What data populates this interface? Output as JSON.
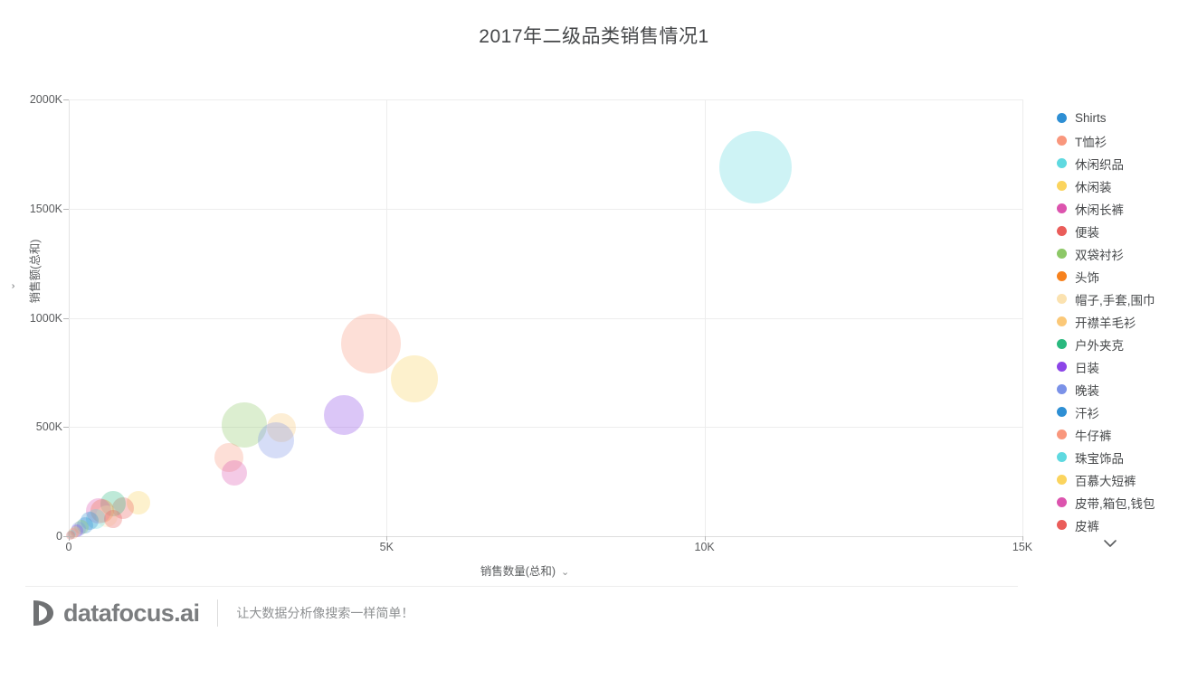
{
  "header": {
    "title": "2017年二级品类销售情况1"
  },
  "axes": {
    "y": {
      "label": "销售额(总和)",
      "caret": "⌄",
      "ticks": [
        "0",
        "500K",
        "1000K",
        "1500K",
        "2000K"
      ]
    },
    "x": {
      "label": "销售数量(总和)",
      "caret": "⌄",
      "ticks": [
        "0",
        "5K",
        "10K",
        "15K"
      ]
    }
  },
  "legend": {
    "more_icon": "chevron-down-icon",
    "items": [
      {
        "label": "Shirts",
        "color": "#2e8fd4"
      },
      {
        "label": "T恤衫",
        "color": "#f9977d"
      },
      {
        "label": "休闲织品",
        "color": "#5fd9e0"
      },
      {
        "label": "休闲装",
        "color": "#fbd45e"
      },
      {
        "label": "休闲长裤",
        "color": "#dc54ae"
      },
      {
        "label": "便装",
        "color": "#ea5d5a"
      },
      {
        "label": "双袋衬衫",
        "color": "#8dc867"
      },
      {
        "label": "头饰",
        "color": "#f7821e"
      },
      {
        "label": "帽子,手套,围巾",
        "color": "#fbe2b0"
      },
      {
        "label": "开襟羊毛衫",
        "color": "#fbc878"
      },
      {
        "label": "户外夹克",
        "color": "#2ab97f"
      },
      {
        "label": "日装",
        "color": "#8c45e8"
      },
      {
        "label": "晚装",
        "color": "#7b92e8"
      },
      {
        "label": "汗衫",
        "color": "#2e8fd4"
      },
      {
        "label": "牛仔裤",
        "color": "#f9977d"
      },
      {
        "label": "珠宝饰品",
        "color": "#5fd9e0"
      },
      {
        "label": "百慕大短裤",
        "color": "#fbd45e"
      },
      {
        "label": "皮带,箱包,钱包",
        "color": "#dc54ae"
      },
      {
        "label": "皮裤",
        "color": "#ea5d5a"
      }
    ]
  },
  "footer": {
    "logo_text": "datafocus.ai",
    "logo_mark": "datafocus-logo-icon",
    "tagline": "让大数据分析像搜索一样简单！"
  },
  "chart_data": {
    "type": "scatter",
    "title": "2017年二级品类销售情况1",
    "xlabel": "销售数量(总和)",
    "ylabel": "销售额(总和)",
    "xlim": [
      0,
      15000
    ],
    "ylim": [
      0,
      2000000
    ],
    "xticks": [
      0,
      5000,
      10000,
      15000
    ],
    "yticks": [
      0,
      500000,
      1000000,
      1500000,
      2000000
    ],
    "grid": true,
    "legend_position": "right",
    "size_encoding": "销售额(总和)",
    "points": [
      {
        "name": "休闲织品",
        "x": 10800,
        "y": 1690000,
        "r": 40,
        "color": "#5fd9e0"
      },
      {
        "name": "T恤衫",
        "x": 4760,
        "y": 880000,
        "r": 33,
        "color": "#f9977d"
      },
      {
        "name": "休闲装",
        "x": 5430,
        "y": 720000,
        "r": 26,
        "color": "#fbd45e"
      },
      {
        "name": "日装",
        "x": 4330,
        "y": 555000,
        "r": 22,
        "color": "#8c45e8"
      },
      {
        "name": "双袋衬衫",
        "x": 2760,
        "y": 508000,
        "r": 25,
        "color": "#8dc867"
      },
      {
        "name": "开襟羊毛衫",
        "x": 3340,
        "y": 495000,
        "r": 16,
        "color": "#fbc878"
      },
      {
        "name": "晚装",
        "x": 3260,
        "y": 440000,
        "r": 20,
        "color": "#7b92e8"
      },
      {
        "name": "牛仔裤",
        "x": 2520,
        "y": 360000,
        "r": 16,
        "color": "#f9977d"
      },
      {
        "name": "休闲长裤",
        "x": 2600,
        "y": 290000,
        "r": 14,
        "color": "#dc54ae"
      },
      {
        "name": "百慕大短裤",
        "x": 1090,
        "y": 155000,
        "r": 13,
        "color": "#fbd45e"
      },
      {
        "name": "便装",
        "x": 860,
        "y": 128000,
        "r": 12,
        "color": "#ea5d5a"
      },
      {
        "name": "户外夹克",
        "x": 700,
        "y": 148000,
        "r": 14,
        "color": "#2ab97f"
      },
      {
        "name": "头饰",
        "x": 520,
        "y": 115000,
        "r": 13,
        "color": "#f7821e"
      },
      {
        "name": "皮带,箱包,钱包",
        "x": 470,
        "y": 118000,
        "r": 14,
        "color": "#dc54ae"
      },
      {
        "name": "帽子,手套,围巾",
        "x": 600,
        "y": 92000,
        "r": 12,
        "color": "#fbe2b0"
      },
      {
        "name": "珠宝饰品",
        "x": 420,
        "y": 78000,
        "r": 11,
        "color": "#5fd9e0"
      },
      {
        "name": "汗衫",
        "x": 330,
        "y": 72000,
        "r": 10,
        "color": "#2e8fd4"
      },
      {
        "name": "皮裤",
        "x": 700,
        "y": 78000,
        "r": 10,
        "color": "#ea5d5a"
      },
      {
        "name": "Shirts",
        "x": 260,
        "y": 50000,
        "r": 9,
        "color": "#2e8fd4"
      },
      {
        "name": "双袋衬衫2",
        "x": 200,
        "y": 42000,
        "r": 8,
        "color": "#8dc867"
      },
      {
        "name": "晚装2",
        "x": 160,
        "y": 34000,
        "r": 8,
        "color": "#7b92e8"
      },
      {
        "name": "日装2",
        "x": 130,
        "y": 26000,
        "r": 7,
        "color": "#8c45e8"
      },
      {
        "name": "休闲装2",
        "x": 100,
        "y": 20000,
        "r": 6,
        "color": "#fbd45e"
      },
      {
        "name": "牛仔裤2",
        "x": 70,
        "y": 14000,
        "r": 6,
        "color": "#f9977d"
      },
      {
        "name": "珠宝饰品2",
        "x": 45,
        "y": 9000,
        "r": 5,
        "color": "#5fd9e0"
      },
      {
        "name": "便装2",
        "x": 25,
        "y": 5000,
        "r": 5,
        "color": "#ea5d5a"
      }
    ]
  }
}
